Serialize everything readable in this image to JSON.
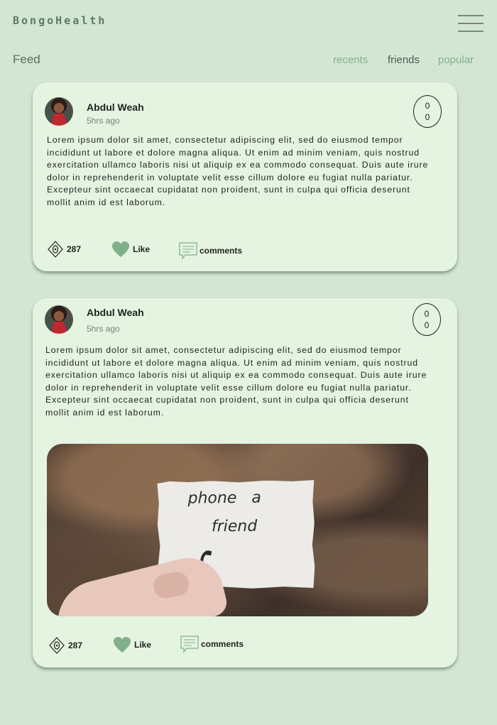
{
  "app": {
    "brand": "BongoHealth"
  },
  "header": {
    "feed_title": "Feed"
  },
  "tabs": [
    {
      "label": "recents",
      "active": false
    },
    {
      "label": "friends",
      "active": true
    },
    {
      "label": "popular",
      "active": false
    }
  ],
  "posts": [
    {
      "author": "Abdul Weah",
      "time": "5hrs ago",
      "badge": [
        "0",
        "0"
      ],
      "text": "Lorem ipsum dolor sit amet, consectetur adipiscing elit, sed do eiusmod tempor incididunt ut labore et dolore magna aliqua. Ut enim ad minim veniam, quis nostrud exercitation ullamco laboris nisi ut aliquip ex ea commodo consequat. Duis aute irure dolor in reprehenderit in voluptate velit esse cillum dolore eu fugiat nulla pariatur. Excepteur sint occaecat cupidatat non proident, sunt in culpa qui officia deserunt mollit anim id est laborum.",
      "views": "287",
      "like_label": "Like",
      "comments_label": "comments"
    },
    {
      "author": "Abdul Weah",
      "time": "5hrs ago",
      "badge": [
        "0",
        "0"
      ],
      "text": "Lorem ipsum dolor sit amet, consectetur adipiscing elit, sed do eiusmod tempor incididunt ut labore et dolore magna aliqua. Ut enim ad minim veniam, quis nostrud exercitation ullamco laboris nisi ut aliquip ex ea commodo consequat. Duis aute irure dolor in reprehenderit in voluptate velit esse cillum dolore eu fugiat nulla pariatur. Excepteur sint occaecat cupidatat non proident, sunt in culpa qui officia deserunt mollit anim id est laborum.",
      "image_text": [
        "phone   a",
        "friend"
      ],
      "views": "287",
      "like_label": "Like",
      "comments_label": "comments"
    }
  ],
  "colors": {
    "background": "#d3e6d4",
    "card": "#e5f3e1",
    "accent": "#7fb08a"
  },
  "icons": [
    "menu-icon",
    "eye-icon",
    "heart-icon",
    "comment-icon",
    "phone-icon"
  ]
}
